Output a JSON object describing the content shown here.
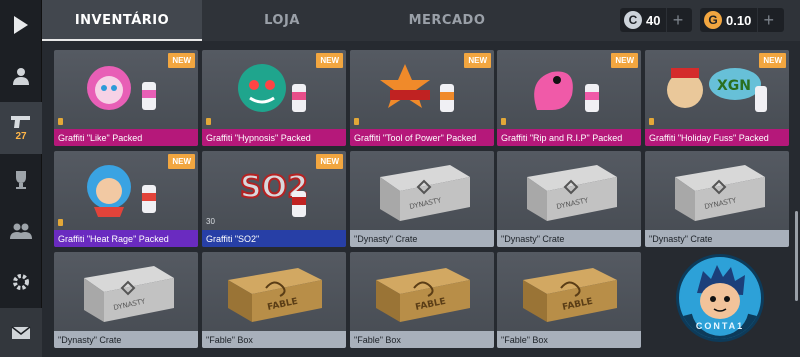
{
  "sidebar": {
    "items": [
      {
        "name": "play-icon",
        "active": false
      },
      {
        "name": "profile-icon",
        "active": false
      },
      {
        "name": "pistol-icon",
        "active": true,
        "count": "27"
      },
      {
        "name": "trophy-icon",
        "active": false
      },
      {
        "name": "friends-icon",
        "active": false
      },
      {
        "name": "settings-icon",
        "active": false
      },
      {
        "name": "mail-icon",
        "active": false
      }
    ]
  },
  "header": {
    "tabs": [
      "INVENTÁRIO",
      "LOJA",
      "MERCADO"
    ],
    "active_tab": 0,
    "silver": {
      "value": "40",
      "icon": "C"
    },
    "gold": {
      "value": "0.10",
      "icon": "G"
    }
  },
  "items": [
    {
      "name": "Graffiti \"Like\" Packed",
      "new": "NEW",
      "color": "pink",
      "art": "graffiti-like"
    },
    {
      "name": "Graffiti \"Hypnosis\" Packed",
      "new": "NEW",
      "color": "pink",
      "art": "graffiti-hypnosis"
    },
    {
      "name": "Graffiti \"Tool of Power\" Packed",
      "new": "NEW",
      "color": "pink",
      "art": "graffiti-power"
    },
    {
      "name": "Graffiti \"Rip and R.I.P\" Packed",
      "new": "NEW",
      "color": "pink",
      "art": "graffiti-rip"
    },
    {
      "name": "Graffiti \"Holiday Fuss\" Packed",
      "new": "NEW",
      "color": "pink",
      "art": "graffiti-holiday"
    },
    {
      "name": "Graffiti \"Heat Rage\" Packed",
      "new": "NEW",
      "color": "purple",
      "art": "graffiti-heat"
    },
    {
      "name": "Graffiti \"SO2\"",
      "new": "NEW",
      "color": "blue",
      "art": "graffiti-so2",
      "stat": "30"
    },
    {
      "name": "\"Dynasty\" Crate",
      "new": "",
      "color": "gray",
      "art": "dynasty-crate"
    },
    {
      "name": "\"Dynasty\" Crate",
      "new": "",
      "color": "gray",
      "art": "dynasty-crate"
    },
    {
      "name": "\"Dynasty\" Crate",
      "new": "",
      "color": "gray",
      "art": "dynasty-crate"
    },
    {
      "name": "\"Dynasty\" Crate",
      "new": "",
      "color": "gray",
      "art": "dynasty-crate"
    },
    {
      "name": "\"Fable\" Box",
      "new": "",
      "color": "gray",
      "art": "fable-box"
    },
    {
      "name": "\"Fable\" Box",
      "new": "",
      "color": "gray",
      "art": "fable-box"
    },
    {
      "name": "\"Fable\" Box",
      "new": "",
      "color": "gray",
      "art": "fable-box"
    }
  ],
  "avatar": {
    "text": "CONTA1"
  }
}
